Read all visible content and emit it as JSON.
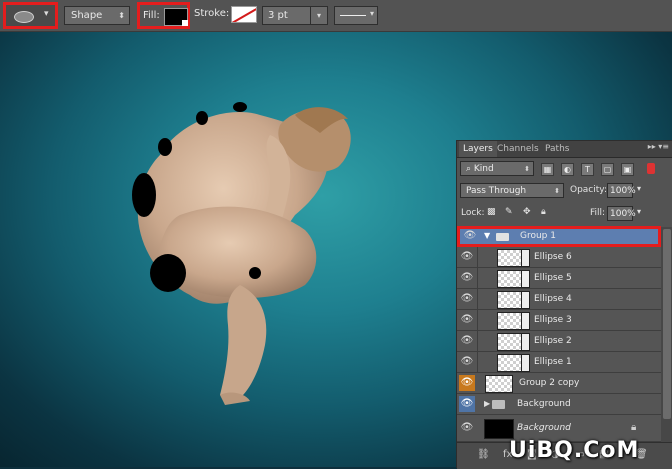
{
  "options_bar": {
    "mode": "Shape",
    "fill_label": "Fill:",
    "stroke_label": "Stroke:",
    "stroke_width": "3 pt",
    "fill_color": "#000000",
    "stroke_color": "#ffffff",
    "highlight_color": "#e41d1d"
  },
  "layers_panel": {
    "tabs": [
      "Layers",
      "Channels",
      "Paths"
    ],
    "filter_kind": "Kind",
    "blend_mode": "Pass Through",
    "opacity_label": "Opacity:",
    "opacity_value": "100%",
    "lock_label": "Lock:",
    "fill_label": "Fill:",
    "fill_value": "100%",
    "layers": [
      {
        "name": "Group 1",
        "type": "group",
        "expanded": true,
        "selected": true
      },
      {
        "name": "Ellipse 6",
        "type": "shape"
      },
      {
        "name": "Ellipse 5",
        "type": "shape"
      },
      {
        "name": "Ellipse 4",
        "type": "shape"
      },
      {
        "name": "Ellipse 3",
        "type": "shape"
      },
      {
        "name": "Ellipse 2",
        "type": "shape"
      },
      {
        "name": "Ellipse 1",
        "type": "shape"
      },
      {
        "name": "Group 2 copy",
        "type": "layer",
        "eye_color": "#c8791d"
      },
      {
        "name": "Background",
        "type": "group",
        "expanded": false,
        "eye_color": "#4f74a6"
      },
      {
        "name": "Background",
        "type": "locked",
        "italic": true
      }
    ]
  },
  "watermark": "UiBQ.CoM"
}
